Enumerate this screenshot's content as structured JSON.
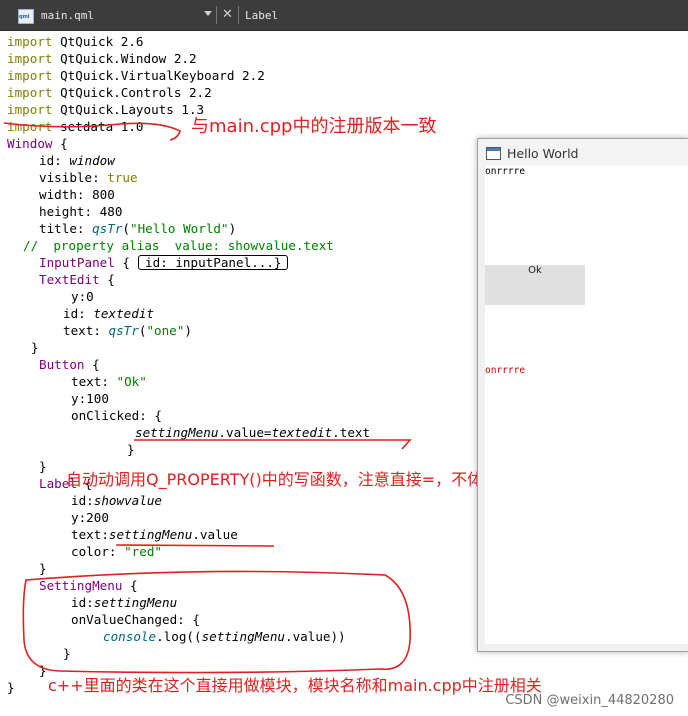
{
  "tab": {
    "file_icon": "qml-file-icon",
    "file_name": "main.qml",
    "dropdown_icon": "chevron-down-icon",
    "close_icon": "close-icon",
    "symbol": "Label"
  },
  "code": {
    "l1_kw": "import",
    "l1_rest": " QtQuick 2.6",
    "l2_kw": "import",
    "l2_rest": " QtQuick.Window 2.2",
    "l3_kw": "import",
    "l3_rest": " QtQuick.VirtualKeyboard 2.2",
    "l4_kw": "import",
    "l4_rest": " QtQuick.Controls 2.2",
    "l5_kw": "import",
    "l5_rest": " QtQuick.Layouts 1.3",
    "l6_kw": "import",
    "l6_rest": " setdata 1.0",
    "l7_type": "Window",
    "l7_rest": " {",
    "l8_a": "id: ",
    "l8_b": "window",
    "l9_a": "visible: ",
    "l9_b": "true",
    "l10": "width: 800",
    "l11": "height: 480",
    "l12_a": "title: ",
    "l12_b": "qsTr",
    "l12_c": "(",
    "l12_d": "\"Hello World\"",
    "l12_e": ")",
    "l13": "//  property alias  value: showvalue.text",
    "l14_type": "InputPanel",
    "l14_rest": " {",
    "l14_fold": "id: inputPanel...}",
    "l15_type": "TextEdit",
    "l15_rest": " {",
    "l16": "y:0",
    "l17_a": "id: ",
    "l17_b": "textedit",
    "l18_a": "text: ",
    "l18_b": "qsTr",
    "l18_c": "(",
    "l18_d": "\"one\"",
    "l18_e": ")",
    "l19": "}",
    "l20_type": "Button",
    "l20_rest": " {",
    "l21_a": "text: ",
    "l21_b": "\"Ok\"",
    "l22": "y:100",
    "l23": "onClicked: {",
    "l24_a": "settingMenu",
    "l24_b": ".value=",
    "l24_c": "textedit",
    "l24_d": ".text",
    "l25": "}",
    "l26": "}",
    "l27_type": "Label",
    "l27_rest": " {",
    "l28_a": "id:",
    "l28_b": "showvalue",
    "l29": "y:200",
    "l30_a": "text:",
    "l30_b": "settingMenu",
    "l30_c": ".value",
    "l31_a": "color: ",
    "l31_b": "\"red\"",
    "l32": "}",
    "l33_type": "SettingMenu",
    "l33_rest": " {",
    "l34_a": "id:",
    "l34_b": "settingMenu",
    "l35": "onValueChanged: {",
    "l36_a": "console",
    "l36_b": ".log((",
    "l36_c": "settingMenu",
    "l36_d": ".value))",
    "l37": "}",
    "l38": "}",
    "l39": "}"
  },
  "annotations": {
    "a1": "与main.cpp中的注册版本一致",
    "a2": "自动动调用Q_PROPERTY()中的写函数，注意直接=，不体现写函数名",
    "a3": "c++里面的类在这个直接用做模块，模块名称和main.cpp中注册相关",
    "ink_color": "#e02020"
  },
  "qt_window": {
    "title_icon": "window-icon",
    "title": "Hello World",
    "input_text": "onrrrre",
    "button_label": "Ok",
    "label_text": "onrrrre",
    "label_color": "#cc0000"
  },
  "watermark": "CSDN @weixin_44820280"
}
